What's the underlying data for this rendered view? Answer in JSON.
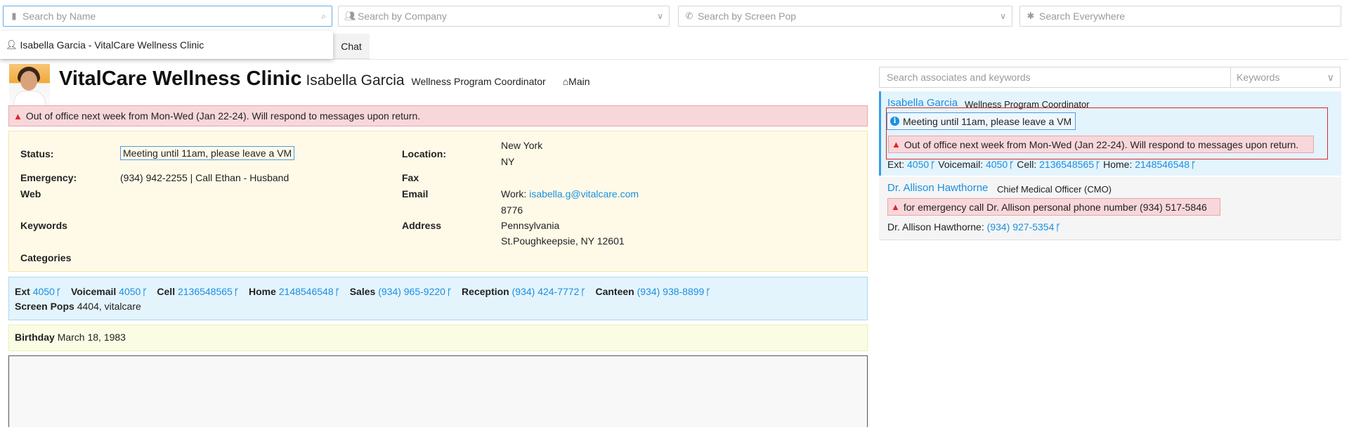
{
  "search": {
    "name_placeholder": "Search by Name",
    "company_placeholder": "Search by Company",
    "screenpop_placeholder": "Search by Screen Pop",
    "everywhere_placeholder": "Search Everywhere"
  },
  "dropdown": {
    "result": "Isabella Garcia - VitalCare Wellness Clinic"
  },
  "tabs": {
    "chat": "Chat"
  },
  "header": {
    "company": "VitalCare Wellness Clinic",
    "person": "Isabella Garcia",
    "role": "Wellness Program Coordinator",
    "main_link": "Main"
  },
  "alert": {
    "text": "Out of office next week from Mon-Wed (Jan 22-24). Will respond to messages upon return."
  },
  "info": {
    "status_label": "Status:",
    "status_value": "Meeting until 11am, please leave a VM",
    "emergency_label": "Emergency:",
    "emergency_value": "(934) 942-2255 | Call Ethan - Husband",
    "web_label": "Web",
    "keywords_label": "Keywords",
    "categories_label": "Categories",
    "location_label": "Location:",
    "location_line1": "New York",
    "location_line2": "NY",
    "fax_label": "Fax",
    "email_label": "Email",
    "email_prefix": "Work: ",
    "email_value": "isabella.g@vitalcare.com",
    "email_line2": "8776",
    "address_label": "Address",
    "address_line1": "Pennsylvania",
    "address_line2": "St.Poughkeepsie, NY 12601"
  },
  "phones": {
    "ext_label": "Ext",
    "ext_value": "4050",
    "voicemail_label": "Voicemail",
    "voicemail_value": "4050",
    "cell_label": "Cell",
    "cell_value": "2136548565",
    "home_label": "Home",
    "home_value": "2148546548",
    "sales_label": "Sales",
    "sales_value": "(934) 965-9220",
    "reception_label": "Reception",
    "reception_value": "(934) 424-7772",
    "canteen_label": "Canteen",
    "canteen_value": "(934) 938-8899",
    "screenpops_label": "Screen Pops",
    "screenpops_value": "4404, vitalcare"
  },
  "birthday": {
    "label": "Birthday",
    "value": "March 18, 1983"
  },
  "associates": {
    "search_placeholder": "Search associates and keywords",
    "keywords_placeholder": "Keywords",
    "a1": {
      "name": "Isabella Garcia",
      "role": "Wellness Program Coordinator",
      "status": "Meeting until 11am, please leave a VM",
      "alert": "Out of office next week from Mon-Wed (Jan 22-24). Will respond to messages upon return.",
      "ext_label": "Ext:",
      "ext_value": "4050",
      "voicemail_label": "Voicemail:",
      "voicemail_value": "4050",
      "cell_label": "Cell:",
      "cell_value": "2136548565",
      "home_label": "Home:",
      "home_value": "2148546548"
    },
    "a2": {
      "name": "Dr. Allison Hawthorne",
      "role": "Chief Medical Officer (CMO)",
      "alert": "for emergency call Dr. Allison personal phone number (934) 517-5846",
      "phone_label": "Dr. Allison Hawthorne:",
      "phone_value": "(934) 927-5354"
    }
  },
  "colors": {
    "link": "#1a8fe0",
    "alert_bg": "#f8d7da",
    "alert_icon": "#e0242c",
    "info_bg": "#fffae8",
    "phones_bg": "#e4f4fd",
    "birthday_bg": "#fafde4"
  },
  "icons": [
    "person-card-icon",
    "search-icon",
    "people-icon",
    "chevron-down-icon",
    "phone-icon",
    "asterisk-icon",
    "user-icon",
    "home-icon",
    "warning-icon",
    "fork-icon",
    "info-icon"
  ]
}
